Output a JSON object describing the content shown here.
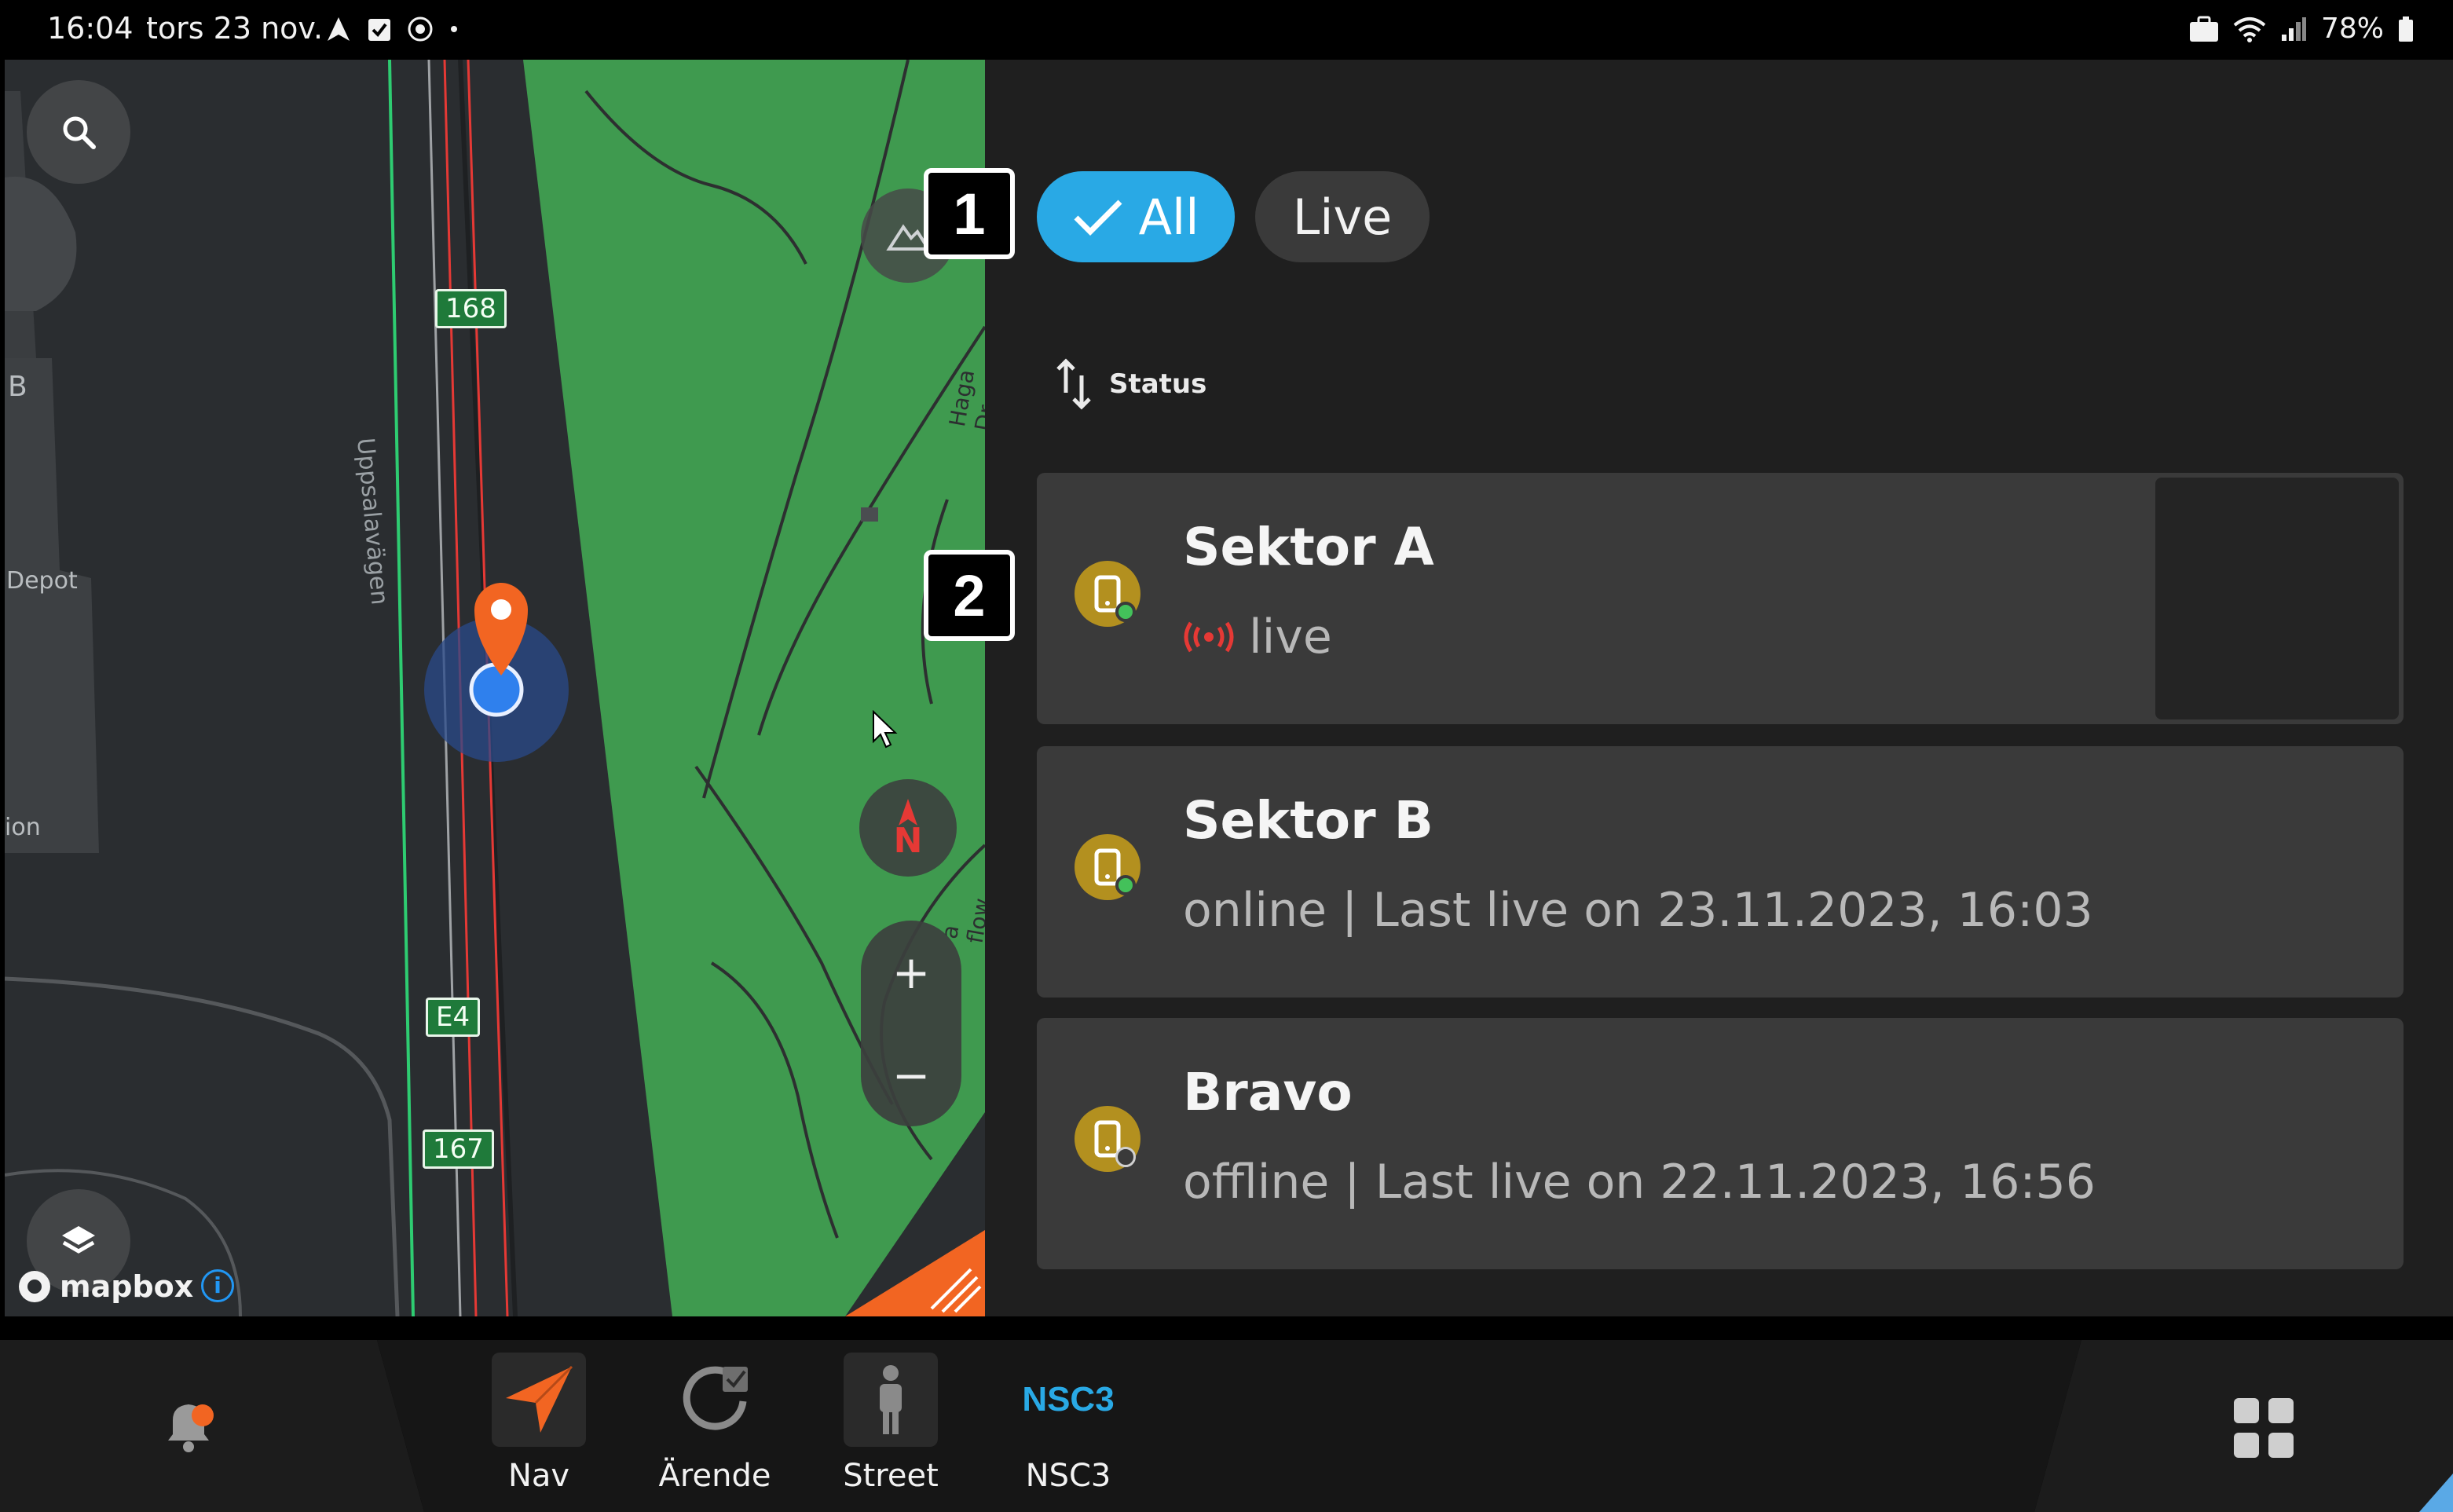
{
  "status_bar": {
    "time": "16:04",
    "date": "tors 23 nov.",
    "battery": "78%"
  },
  "map": {
    "road_signs": [
      "168",
      "E4",
      "167"
    ],
    "street_name": "Uppsalavägen",
    "labels": [
      "B",
      "Depot",
      "ion",
      "Haga Dr",
      "a flow"
    ],
    "compass_letter": "N",
    "zoom_in": "+",
    "zoom_out": "−",
    "attribution": "mapbox",
    "info": "i"
  },
  "filters": {
    "all_label": "All",
    "live_label": "Live",
    "selected": "All"
  },
  "sort": {
    "label": "Status"
  },
  "devices": [
    {
      "name": "Sektor A",
      "status_text": "live",
      "status": "live"
    },
    {
      "name": "Sektor B",
      "status_text": "online | Last live on 23.11.2023, 16:03",
      "status": "online"
    },
    {
      "name": "Bravo",
      "status_text": "offline | Last live on 22.11.2023, 16:56",
      "status": "offline"
    }
  ],
  "callouts": [
    "1",
    "2"
  ],
  "bottom_nav": {
    "items": [
      {
        "label": "Nav",
        "icon": "navigation-arrow-icon"
      },
      {
        "label": "Ärende",
        "icon": "case-refresh-icon"
      },
      {
        "label": "Street",
        "icon": "person-icon"
      },
      {
        "label": "NSC3",
        "icon": "nsc3-logo"
      }
    ],
    "nsc3_logo_text": "NSC3"
  },
  "colors": {
    "accent": "#29a9e5",
    "live_red": "#e53935",
    "online_green": "#43c15a",
    "device_gold": "#b3901f",
    "map_green": "#3f9a4f",
    "marker_orange": "#f26522"
  }
}
